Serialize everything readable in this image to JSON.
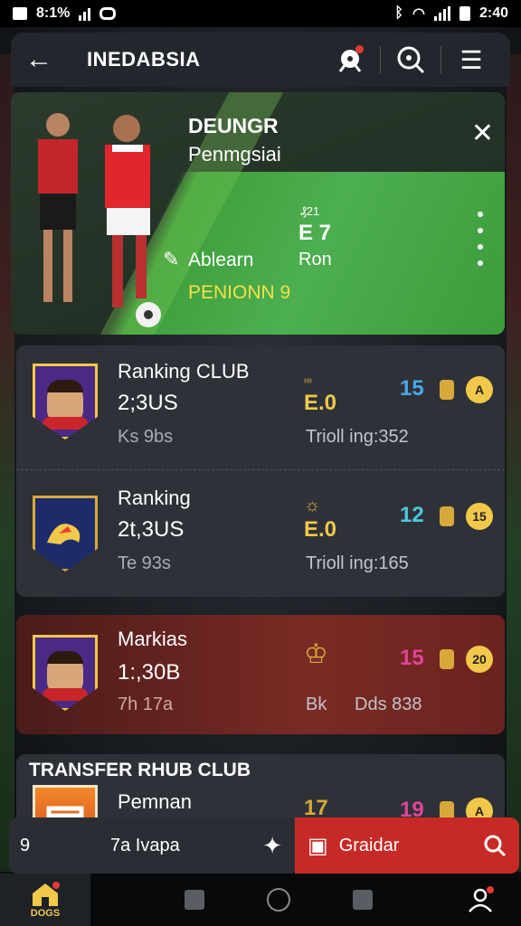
{
  "status_bar": {
    "time_left": "8:1%",
    "time_right": "2:40"
  },
  "header": {
    "title": "INEDABSIA",
    "back_glyph": "←",
    "menu_glyph": "☰"
  },
  "hero": {
    "title": "DEUNGR",
    "subtitle": "Penmgsiai",
    "close_glyph": "✕",
    "player_name": "Ablearn",
    "mini_label": "₰21",
    "score": "E 7",
    "position": "Ron",
    "pension": "PENIONN 9"
  },
  "cards": [
    {
      "name": "Ranking CLUB",
      "value": "2;3US",
      "sub": "Ks  9bs",
      "icon_label": "ᶦᶦᶦᶦ",
      "e_value": "E.0",
      "training": "Trioll ing:352",
      "number": "15",
      "number_color": "#4aa8e8",
      "coin_label": "A"
    },
    {
      "name": "Ranking",
      "value": "2t,3US",
      "sub": "Te  93s",
      "icon_label": "☼",
      "e_value": "E.0",
      "training": "Trioll ing:165",
      "number": "12",
      "number_color": "#4ec6e0",
      "coin_label": "15"
    },
    {
      "name": "Markias",
      "value": "1:,30B",
      "sub": "7h  17a",
      "icon_label": "♔",
      "e_value": "Bk",
      "training": "Dds 838",
      "number": "15",
      "number_color": "#e0449a",
      "coin_label": "20"
    },
    {
      "section_title": "TRANSFER RHUB CLUB",
      "name": "Pemnan",
      "number": "19",
      "number_color": "#e0449a",
      "coin_label": "A",
      "icon_label": "17"
    }
  ],
  "action_bar": {
    "num": "9",
    "text": "7a Ivapa",
    "star_glyph": "✦",
    "button_label": "Graidar"
  },
  "nav": {
    "home_label": "DOGS"
  },
  "colors": {
    "accent_green": "#4caf50",
    "accent_red": "#c72a26",
    "gold": "#f2c84b"
  }
}
